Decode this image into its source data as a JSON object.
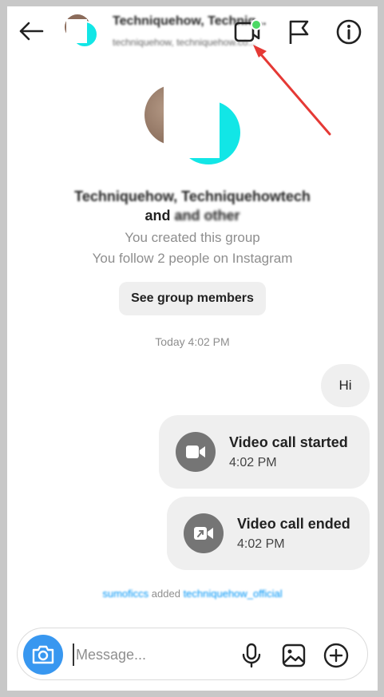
{
  "header": {
    "group_name": "Techniquehow, Techniq...",
    "group_sub": "techniquehow, techniquehow.co..."
  },
  "intro": {
    "members_line1": "Techniquehow, Techniquehowtech",
    "members_and": "and",
    "members_rest": "and other",
    "created_text": "You created this group",
    "follow_text": "You follow 2 people on Instagram",
    "see_members_label": "See group members"
  },
  "timestamp": "Today 4:02 PM",
  "messages": {
    "hi": "Hi",
    "call_started": {
      "title": "Video call started",
      "time": "4:02 PM"
    },
    "call_ended": {
      "title": "Video call ended",
      "time": "4:02 PM"
    }
  },
  "added": {
    "actor": "sumoficcs",
    "verb": "added",
    "target": "techniquehow_official"
  },
  "composer": {
    "placeholder": "Message..."
  },
  "colors": {
    "accent": "#3897f0",
    "active_dot": "#4cd964",
    "annotation_arrow": "#e53935",
    "bubble": "#efefef"
  },
  "icons": [
    "back-arrow-icon",
    "video-camera-icon",
    "flag-icon",
    "info-icon",
    "video-icon",
    "call-ended-icon",
    "camera-icon",
    "microphone-icon",
    "gallery-icon",
    "plus-icon"
  ]
}
